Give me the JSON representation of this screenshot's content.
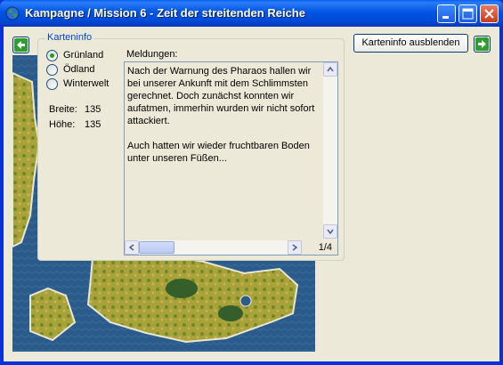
{
  "window": {
    "title": "Kampagne / Mission 6 - Zeit der streitenden Reiche",
    "icon": "globe-icon",
    "controls": [
      "minimize-icon",
      "maximize-icon",
      "close-icon"
    ]
  },
  "nav": {
    "back_icon": "arrow-left-icon",
    "forward_icon": "arrow-right-icon",
    "accent": "#2f9e2f"
  },
  "toggle_button": {
    "label": "Karteninfo ausblenden"
  },
  "karteninfo": {
    "title": "Karteninfo",
    "terrain_options": [
      {
        "label": "Grünland",
        "selected": true
      },
      {
        "label": "Ödland",
        "selected": false
      },
      {
        "label": "Winterwelt",
        "selected": false
      }
    ],
    "width_label": "Breite:",
    "width_value": "135",
    "height_label": "Höhe:",
    "height_value": "135"
  },
  "messages": {
    "heading": "Meldungen:",
    "paragraphs": [
      "Nach der Warnung des Pharaos hallen wir bei unserer Ankunft mit dem Schlimmsten gerechnet. Doch zunächst konnten wir aufatmen, immerhin wurden wir nicht sofort attackiert.",
      "Auch hatten wir wieder fruchtbaren Boden unter unseren Füßen..."
    ],
    "page": "1/4"
  },
  "colors": {
    "titlebar": "#0054e3",
    "dialog_bg": "#ece9d8",
    "group_title": "#0046d5",
    "water": "#2a5b8a",
    "land": "#a8a238"
  }
}
